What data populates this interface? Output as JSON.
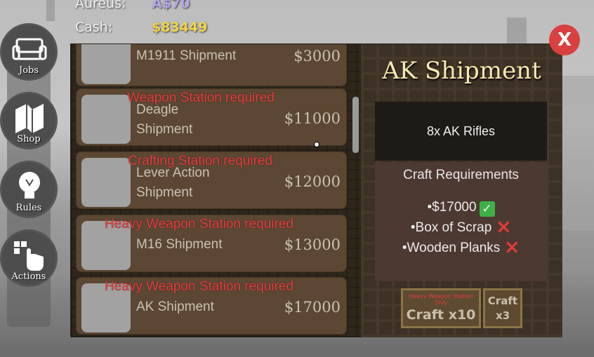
{
  "currency": {
    "aureus_label": "Aureus:",
    "aureus_value": "A$70",
    "cash_label": "Cash:",
    "cash_value": "$83449"
  },
  "nav": {
    "jobs": "Jobs",
    "shop": "Shop",
    "rules": "Rules",
    "actions": "Actions"
  },
  "shop_list": [
    {
      "name": "M1911 Shipment",
      "price": "$3000",
      "requirement": ""
    },
    {
      "name": "Deagle\nShipment",
      "price": "$11000",
      "requirement": "Weapon Station required"
    },
    {
      "name": "Lever Action\nShipment",
      "price": "$12000",
      "requirement": "Crafting Station required"
    },
    {
      "name": "M16 Shipment",
      "price": "$13000",
      "requirement": "Heavy Weapon Station required"
    },
    {
      "name": "AK Shipment",
      "price": "$17000",
      "requirement": "Heavy Weapon Station required"
    }
  ],
  "detail": {
    "title": "AK Shipment",
    "contents": "8x AK Rifles",
    "requirements_title": "Craft Requirements",
    "requirements": [
      {
        "text": "•$17000",
        "met": true
      },
      {
        "text": "•Box of Scrap",
        "met": false
      },
      {
        "text": "•Wooden Planks",
        "met": false
      }
    ],
    "craft10_note": "Heavy Weapon Station Only",
    "craft10_label": "Craft x10",
    "craft3_label": "Craft\nx3"
  },
  "close_label": "X",
  "colors": {
    "requirement_text": "#e84040",
    "aureus": "#b6a7e8",
    "cash": "#f2d54a",
    "close": "#d94040"
  }
}
